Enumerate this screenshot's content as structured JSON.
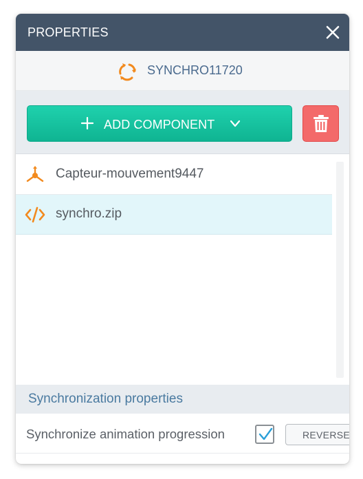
{
  "header": {
    "title": "PROPERTIES",
    "close_icon": "close-icon"
  },
  "entity": {
    "name": "SYNCHRO11720",
    "icon": "sync-arrows-icon",
    "icon_color": "#f28a1e"
  },
  "toolbar": {
    "add_label": "ADD COMPONENT",
    "add_icon": "plus-icon",
    "dropdown_icon": "chevron-down-icon",
    "delete_icon": "trash-icon",
    "add_color": "#17c4a1",
    "delete_color": "#f36a6a"
  },
  "components": [
    {
      "label": "Capteur-mouvement9447",
      "icon": "motion-sensor-icon",
      "selected": false
    },
    {
      "label": "synchro.zip",
      "icon": "code-icon",
      "selected": true
    }
  ],
  "section": {
    "title": "Synchronization properties"
  },
  "properties": {
    "sync_label": "Synchronize animation progression",
    "sync_checked": true,
    "reverse_label": "REVERSE"
  },
  "colors": {
    "header_bg": "#435468",
    "accent_orange": "#f28a1e",
    "selected_bg": "#e2f6fa",
    "section_text": "#4a7aa0"
  }
}
